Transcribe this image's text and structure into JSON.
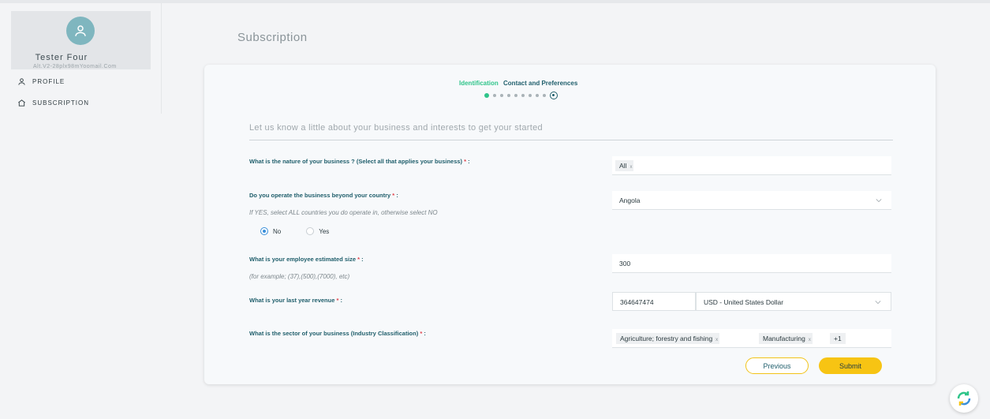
{
  "user": {
    "name": "Tester Four",
    "email": "Alt.V2-28plx98mYoomail.Com"
  },
  "nav": {
    "profile": "PROFILE",
    "subscription": "SUBSCRIPTION"
  },
  "page": {
    "title": "Subscription"
  },
  "steps": {
    "active": "Identification",
    "next": "Contact and Preferences"
  },
  "form": {
    "intro": "Let us know a little about your business and interests to get your started",
    "q_nature": "What is the nature of your business ? (Select all that applies your business)",
    "nature_tag": "All",
    "q_beyond": "Do you operate the business beyond your country",
    "beyond_hint": "If YES, select ALL countries you do operate in, otherwise select NO",
    "country_value": "Angola",
    "radio_no": "No",
    "radio_yes": "Yes",
    "q_employees": "What is your employee estimated size",
    "employees_hint": "(for example; (37),(500),(7000), etc)",
    "employees_value": "300",
    "q_revenue": "What is your last year revenue",
    "revenue_value": "364647474",
    "currency_value": "USD - United States Dollar",
    "q_sector": "What is the sector of your business (Industry Classification)",
    "sector_tag_1": "Agriculture; forestry and fishing",
    "sector_tag_2": "Manufacturing",
    "sector_more": "+1",
    "required_mark": "*",
    "colon": ":",
    "tag_remove": "x"
  },
  "buttons": {
    "previous": "Previous",
    "submit": "Submit"
  },
  "colors": {
    "accent_green": "#2fc48a",
    "primary_teal": "#1f5e6b",
    "button_yellow": "#f7c413"
  },
  "icons": [
    "user-icon",
    "home-icon",
    "chevron-down-icon",
    "sync-icon"
  ]
}
